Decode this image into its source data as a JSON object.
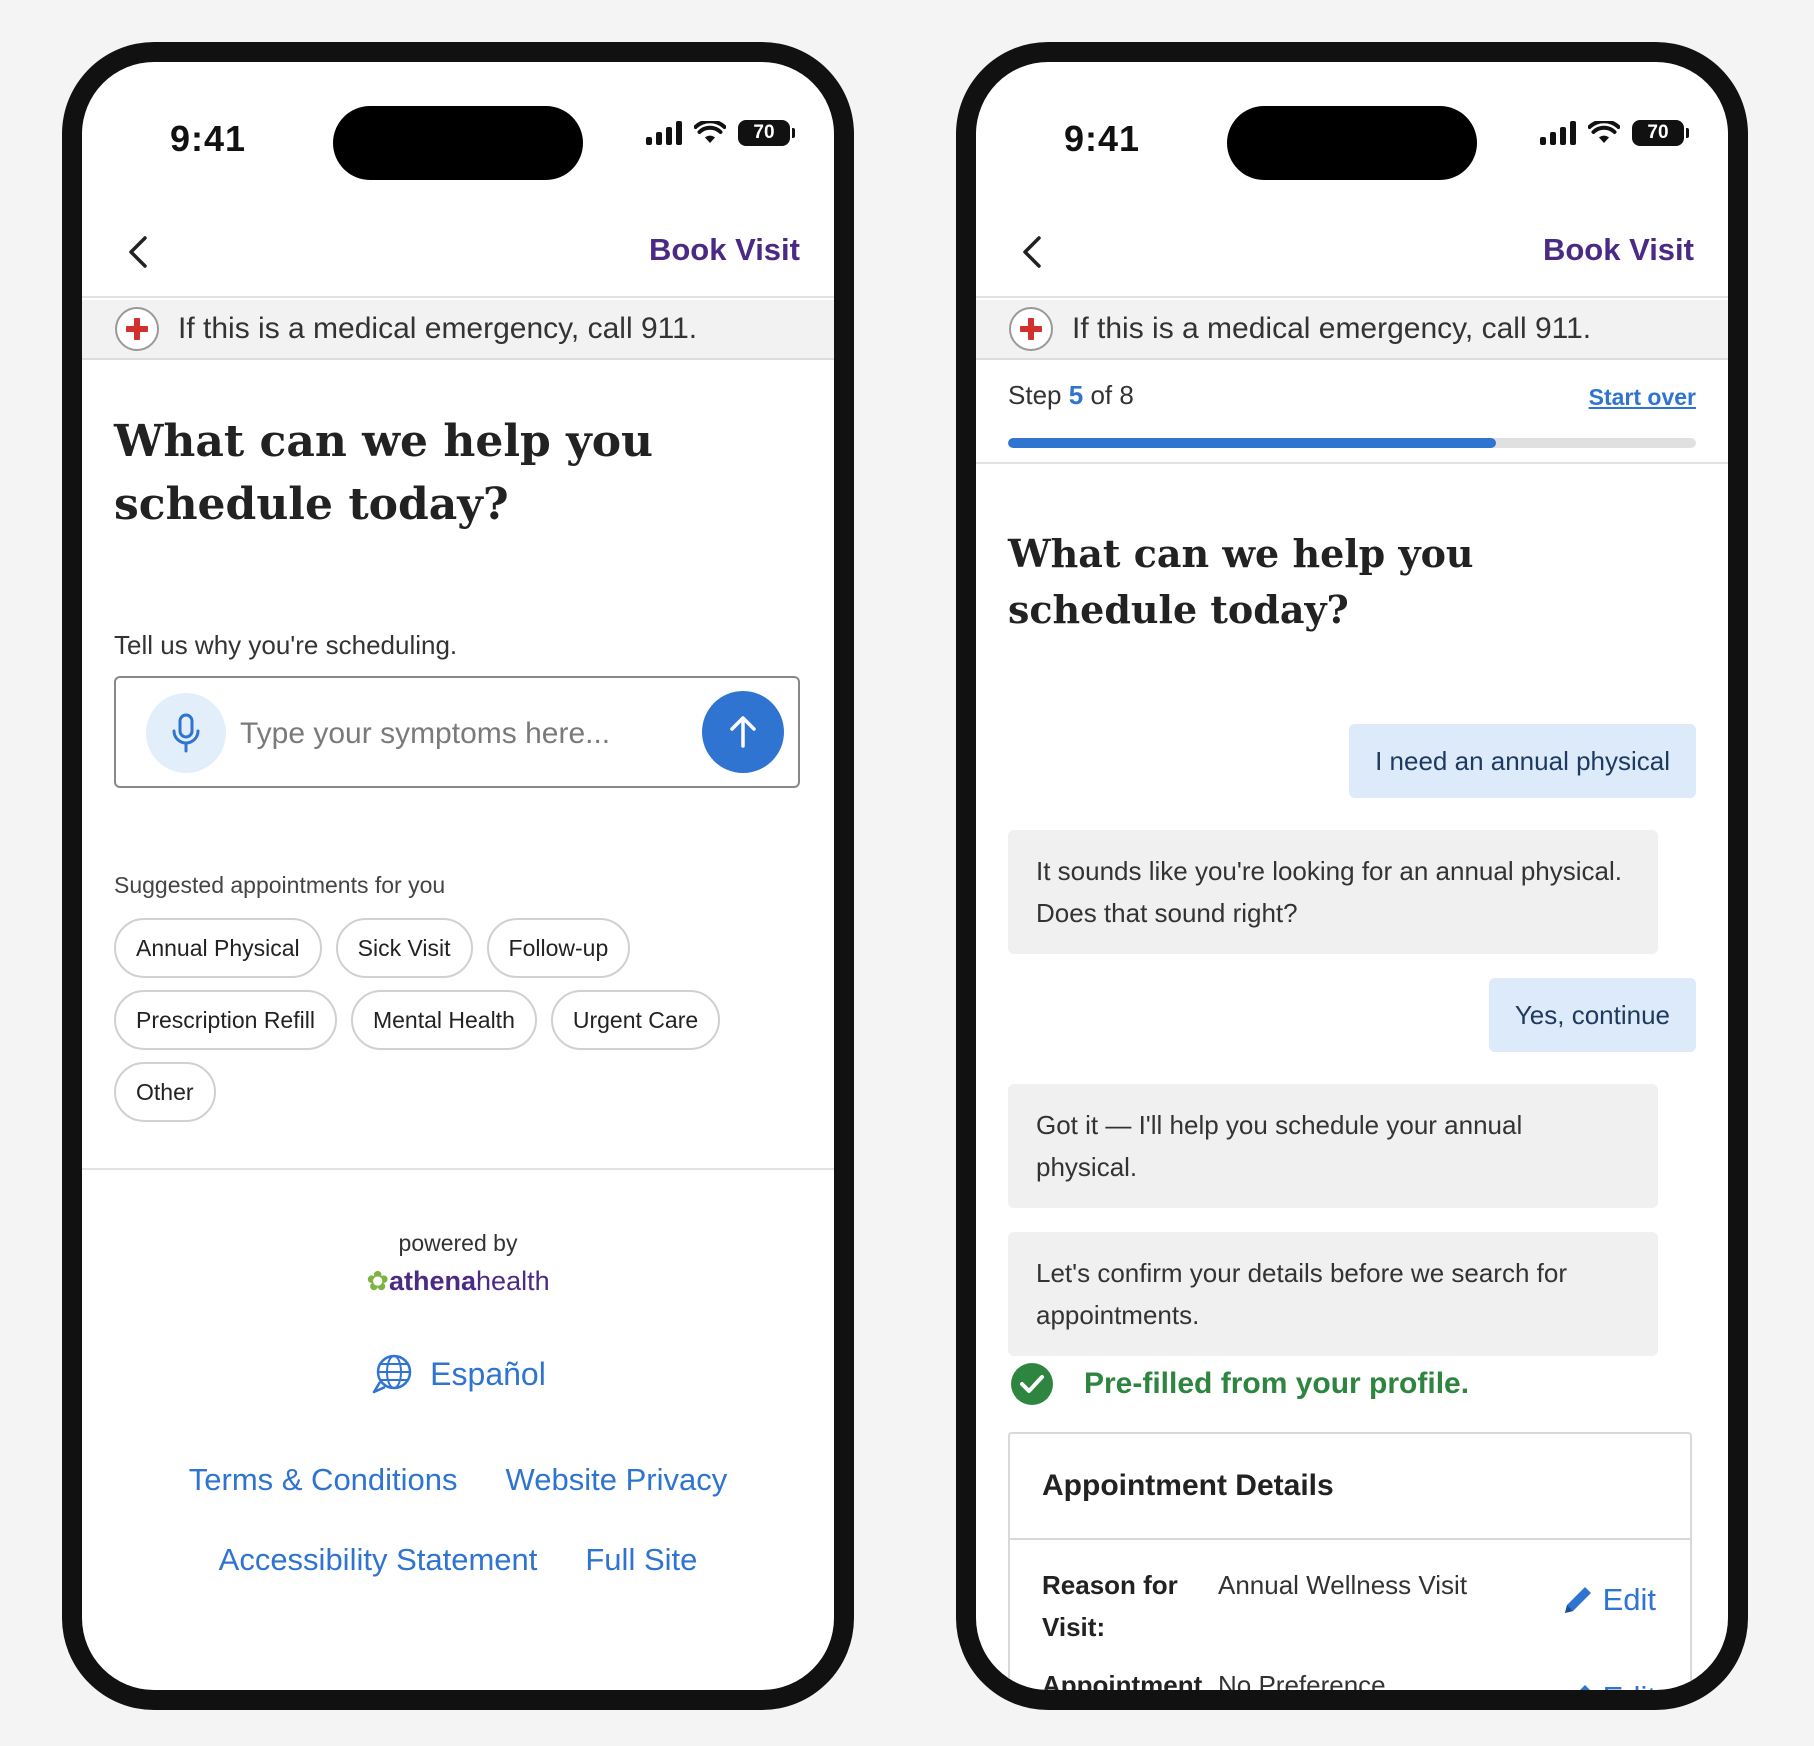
{
  "status_bar": {
    "time": "9:41",
    "battery": "70"
  },
  "header": {
    "title": "Book Visit"
  },
  "emergency_text": "If this is a medical emergency, call 911.",
  "left_screen": {
    "headline": "What can we help you schedule today?",
    "prompt_label": "Tell us why you're scheduling.",
    "symptom_placeholder": "Type your symptoms here...",
    "suggested_label": "Suggested appointments for you",
    "chips": [
      "Annual Physical",
      "Sick Visit",
      "Follow-up",
      "Prescription Refill",
      "Mental Health",
      "Urgent Care",
      "Other"
    ],
    "powered_by": "powered by",
    "brand": {
      "part1": "athena",
      "part2": "health"
    },
    "language_link": "Español",
    "footer_links": [
      "Terms & Conditions",
      "Website Privacy",
      "Accessibility Statement",
      "Full Site"
    ]
  },
  "right_screen": {
    "step": {
      "prefix": "Step",
      "current": "5",
      "suffix": "of 8",
      "progress_fraction": 0.71
    },
    "start_over": "Start over",
    "headline": "What can we help you schedule today?",
    "messages": [
      {
        "from": "user",
        "text": "I need an annual physical"
      },
      {
        "from": "bot",
        "text": "It sounds like you're looking for an annual physical. Does that sound right?"
      },
      {
        "from": "user",
        "text": "Yes, continue"
      },
      {
        "from": "bot",
        "text": "Got it — I'll help you schedule your annual physical."
      },
      {
        "from": "bot",
        "text": "Let's confirm your details before we search for appointments."
      }
    ],
    "prefill_note": "Pre-filled from your profile.",
    "details_title": "Appointment Details",
    "details": [
      {
        "label": "Reason for Visit:",
        "value": "Annual Wellness Visit",
        "edit": "Edit"
      },
      {
        "label": "Appointment Type:",
        "value": "No Preference",
        "edit": "Edit"
      }
    ]
  },
  "colors": {
    "brand_purple": "#4b2a85",
    "link_blue": "#2f74d0",
    "success_green": "#2e8540",
    "emergency_red": "#d32f2f",
    "user_bubble": "#dceafa",
    "bot_bubble": "#f0f0f0"
  }
}
